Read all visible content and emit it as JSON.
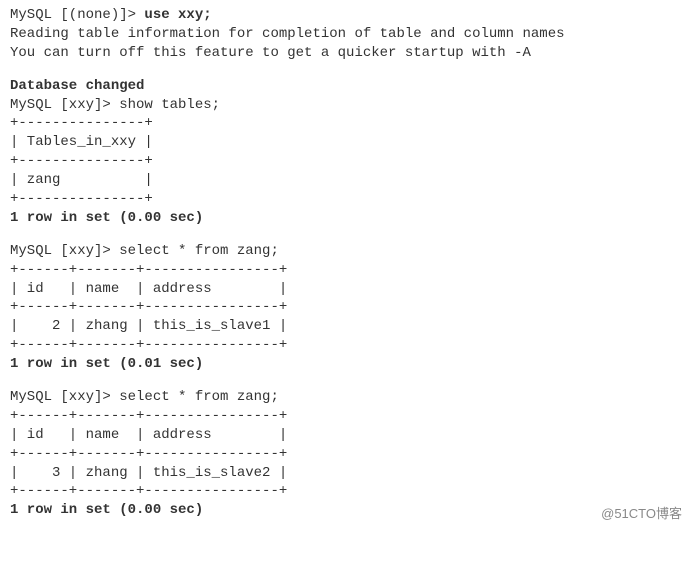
{
  "prompt1": "MySQL [(none)]> ",
  "cmd_use": "use xxy;",
  "info_line1": "Reading table information for completion of table and column names",
  "info_line2": "You can turn off this feature to get a quicker startup with -A",
  "db_changed": "Database changed",
  "prompt2": "MySQL [xxy]> ",
  "cmd_show": "show tables;",
  "tables_border": "+---------------+",
  "tables_header": "| Tables_in_xxy |",
  "tables_row": "| zang          |",
  "tables_result": "1 row in set (0.00 sec)",
  "cmd_select": "select * from zang;",
  "sel1_border": "+------+-------+----------------+",
  "sel1_header": "| id   | name  | address        |",
  "sel1_row": "|    2 | zhang | this_is_slave1 |",
  "sel1_result": "1 row in set (0.01 sec)",
  "sel2_border": "+------+-------+----------------+",
  "sel2_header": "| id   | name  | address        |",
  "sel2_row": "|    3 | zhang | this_is_slave2 |",
  "sel2_result": "1 row in set (0.00 sec)",
  "watermark": "@51CTO博客"
}
